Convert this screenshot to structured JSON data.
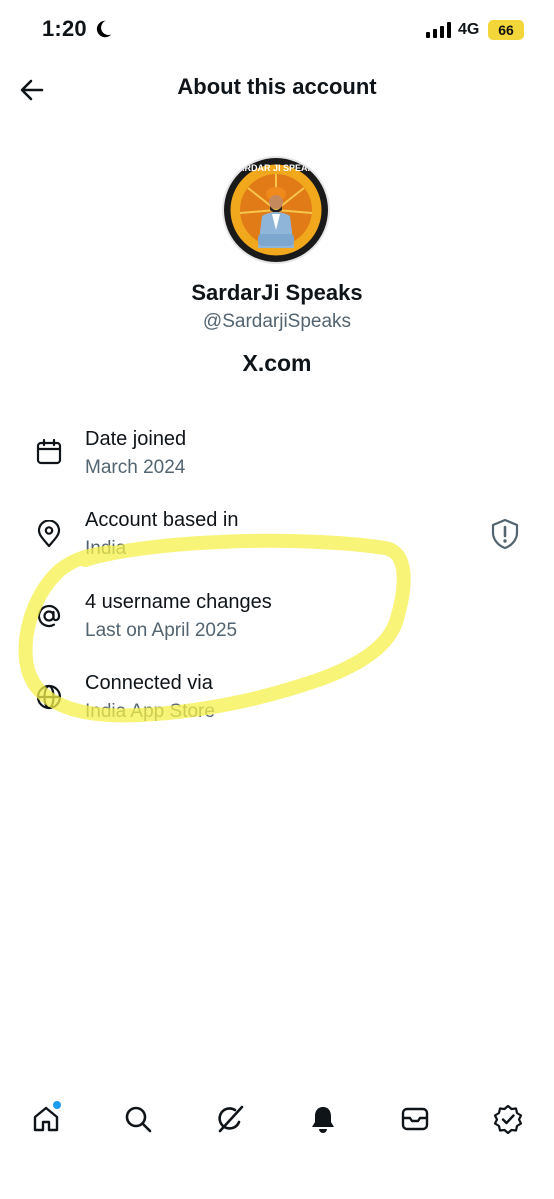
{
  "status_bar": {
    "time": "1:20",
    "network": "4G",
    "battery": "66"
  },
  "header": {
    "title": "About this account"
  },
  "profile": {
    "name": "SardarJi Speaks",
    "handle": "@SardarjiSpeaks",
    "brand": "X.com",
    "avatar_text": "SARDAR JI SPEAKS"
  },
  "rows": [
    {
      "title": "Date joined",
      "subtitle": "March 2024",
      "icon": "calendar-icon"
    },
    {
      "title": "Account based in",
      "subtitle": "India",
      "icon": "location-pin-icon"
    },
    {
      "title": "4 username changes",
      "subtitle": "Last on April 2025",
      "icon": "at-sign-icon"
    },
    {
      "title": "Connected via",
      "subtitle": "India App Store",
      "icon": "globe-icon"
    }
  ],
  "bottom_nav": [
    "home-icon",
    "search-icon",
    "grok-icon",
    "notifications-bell-icon",
    "messages-icon",
    "verified-icon"
  ],
  "colors": {
    "text": "#0f1419",
    "secondary": "#536471",
    "highlight": "#f6f04a",
    "accent": "#1d9bf0"
  }
}
